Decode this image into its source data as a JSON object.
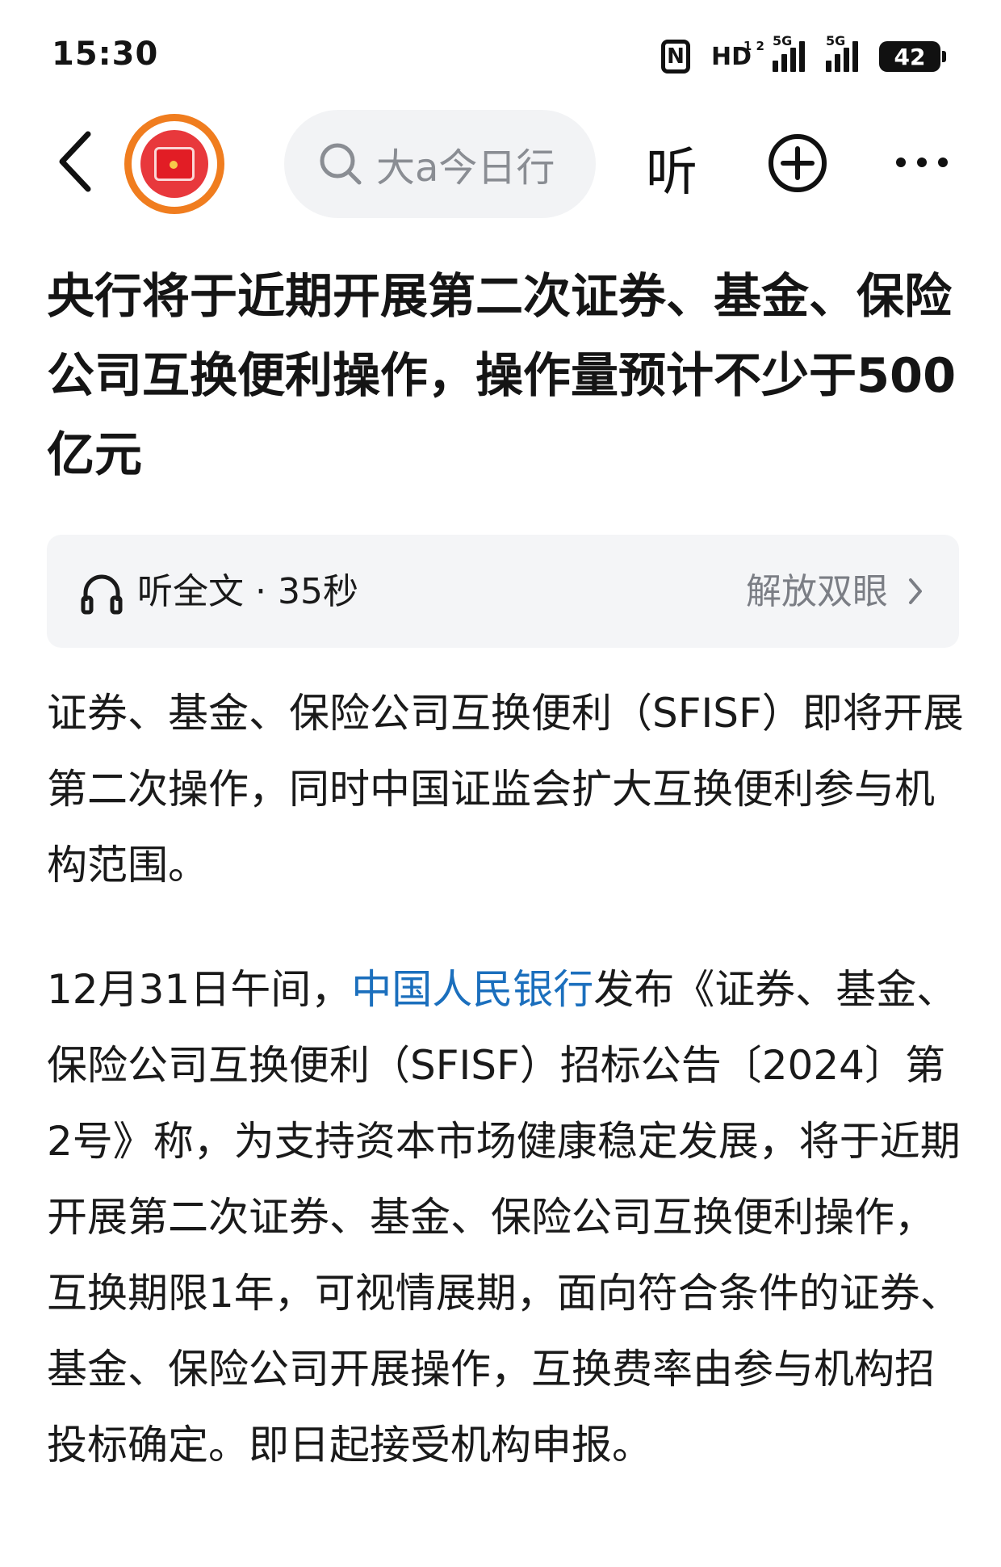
{
  "status_bar": {
    "time": "15:30",
    "nfc_label": "N",
    "hd_label": "HD",
    "hd_sub": "1 2",
    "signal1_type": "5G",
    "signal2_type": "5G",
    "battery": "42"
  },
  "nav": {
    "search_placeholder": "大a今日行",
    "listen_label": "听"
  },
  "article": {
    "title": "央行将于近期开展第二次证券、基金、保险公司互换便利操作，操作量预计不少于500亿元",
    "audio": {
      "label": "听全文 · 35秒",
      "release_label": "解放双眼"
    },
    "para1": "证券、基金、保险公司互换便利（SFISF）即将开展第二次操作，同时中国证监会扩大互换便利参与机构范围。",
    "para2_prefix": "12月31日午间，",
    "para2_link": "中国人民银行",
    "para2_rest": "发布《证券、基金、保险公司互换便利（SFISF）招标公告〔2024〕第2号》称，为支持资本市场健康稳定发展，将于近期开展第二次证券、基金、保险公司互换便利操作，互换期限1年，可视情展期，面向符合条件的证券、基金、保险公司开展操作，互换费率由参与机构招投标确定。即日起接受机构申报。"
  },
  "colors": {
    "link": "#1b6fbd",
    "logo_ring": "#f07d1f",
    "logo_red": "#e8383c"
  },
  "icons": [
    "back-arrow-icon",
    "app-logo-icon",
    "search-icon",
    "plus-circle-icon",
    "more-icon",
    "headphone-icon",
    "chevron-right-icon"
  ]
}
